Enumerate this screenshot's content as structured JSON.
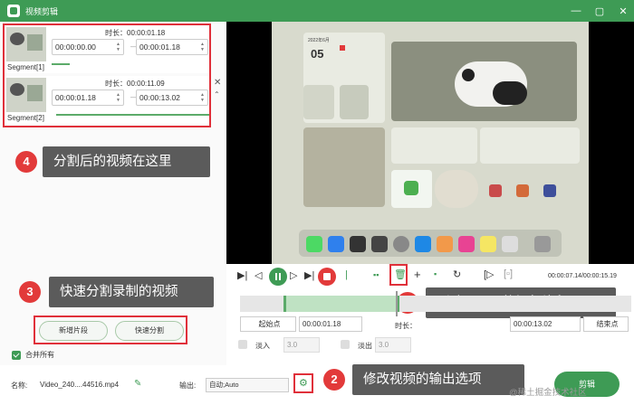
{
  "window": {
    "title": "视频剪辑",
    "controls": [
      "—",
      "▢",
      "✕"
    ]
  },
  "segments": [
    {
      "label": "Segment[1]",
      "duration": "时长：00:00:01.18",
      "start": "00:00:00.00",
      "end": "00:00:01.18"
    },
    {
      "label": "Segment[2]",
      "duration": "时长：00:00:11.09",
      "start": "00:00:01.18",
      "end": "00:00:13.02"
    }
  ],
  "callouts": {
    "c4": {
      "num": "4",
      "text": "分割后的视频在这里"
    },
    "c3": {
      "num": "3",
      "text": "快速分割录制的视频"
    },
    "c1": {
      "num": "1",
      "text": "删除不需要的视频片段"
    },
    "c2": {
      "num": "2",
      "text": "修改视频的输出选项"
    }
  },
  "buttons": {
    "new_segment": "新增片段",
    "quick_split": "快速分割",
    "edit": "剪辑"
  },
  "merge_all": "合并所有",
  "playback": {
    "timecode": "00:00:07.14/00:00:15.19"
  },
  "edit": {
    "start_label": "起始点",
    "start_value": "00:00:01.18",
    "duration_label": "时长：",
    "end_value": "00:00:13.02",
    "end_label": "结束点",
    "fade_in_label": "淡入",
    "fade_in_value": "3.0",
    "fade_out_label": "淡出",
    "fade_out_value": "3.0"
  },
  "output": {
    "name_label": "名称:",
    "name_value": "Video_240....44516.mp4",
    "output_label": "输出:",
    "output_value": "自动;Auto"
  },
  "watermark": "@稀土掘金技术社区",
  "preview_screen": {
    "date_num": "05",
    "month": "2022年6月"
  }
}
